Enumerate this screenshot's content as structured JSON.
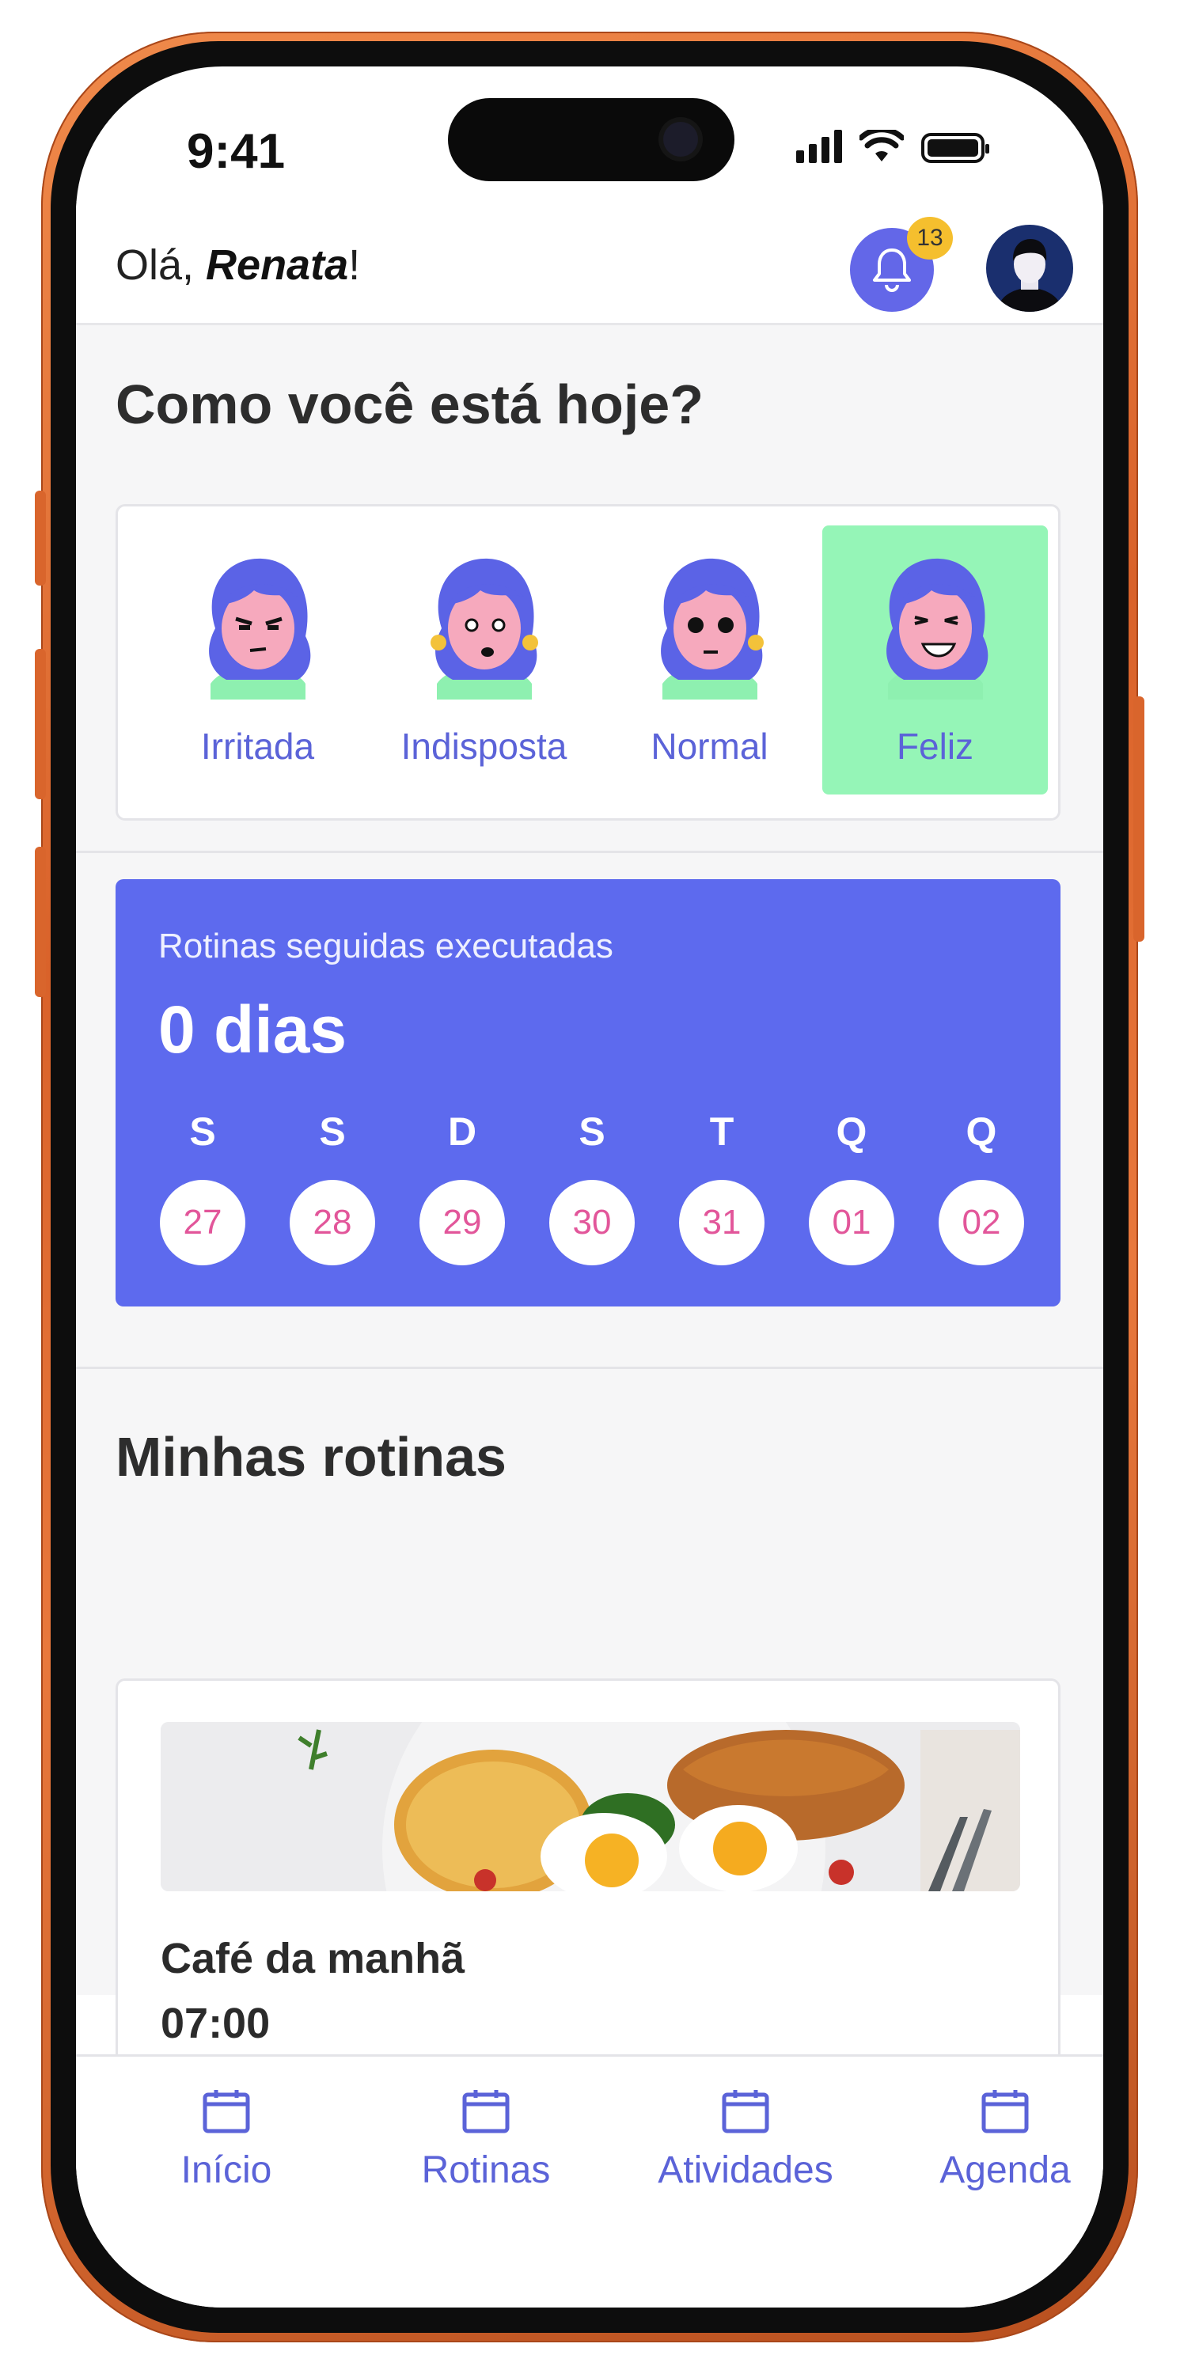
{
  "status_bar": {
    "time": "9:41"
  },
  "header": {
    "greeting_prefix": "Olá, ",
    "user_name": "Renata",
    "greeting_suffix": "!",
    "notification_count": "13"
  },
  "mood_section": {
    "title": "Como você está hoje?",
    "options": [
      {
        "label": "Irritada",
        "icon": "angry-face-icon",
        "selected": false
      },
      {
        "label": "Indisposta",
        "icon": "unwell-face-icon",
        "selected": false
      },
      {
        "label": "Normal",
        "icon": "neutral-face-icon",
        "selected": false
      },
      {
        "label": "Feliz",
        "icon": "happy-face-icon",
        "selected": true
      }
    ],
    "selected_color": "#95F5B7"
  },
  "streak": {
    "subtitle": "Rotinas seguidas executadas",
    "value": "0 dias",
    "days": [
      {
        "letter": "S",
        "number": "27"
      },
      {
        "letter": "S",
        "number": "28"
      },
      {
        "letter": "D",
        "number": "29"
      },
      {
        "letter": "S",
        "number": "30"
      },
      {
        "letter": "T",
        "number": "31"
      },
      {
        "letter": "Q",
        "number": "01"
      },
      {
        "letter": "Q",
        "number": "02"
      }
    ],
    "card_color": "#5D6AEE",
    "day_number_color": "#E2569A"
  },
  "routines": {
    "title": "Minhas rotinas",
    "items": [
      {
        "name": "Café da manhã",
        "time": "07:00",
        "image": "breakfast-photo"
      }
    ]
  },
  "bottom_nav": {
    "items": [
      {
        "label": "Início",
        "icon": "calendar-icon"
      },
      {
        "label": "Rotinas",
        "icon": "calendar-icon"
      },
      {
        "label": "Atividades",
        "icon": "calendar-icon"
      },
      {
        "label": "Agenda",
        "icon": "calendar-icon"
      }
    ],
    "accent": "#5B63D8"
  },
  "phone_frame_color": "#E9783C"
}
